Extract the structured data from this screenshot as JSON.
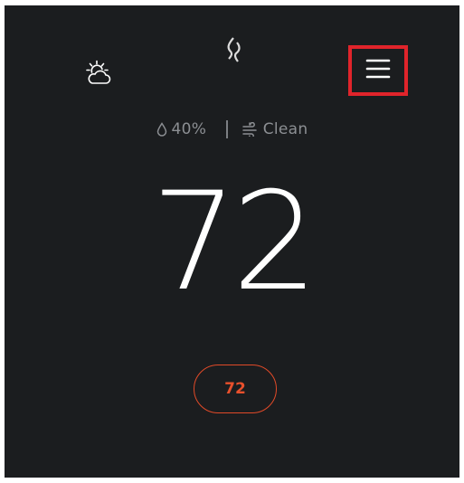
{
  "header": {
    "weather_icon": "partly-cloudy-icon",
    "logo_icon": "flame-logo-icon",
    "menu_icon": "hamburger-menu-icon",
    "menu_highlight_color": "#e0242b"
  },
  "status": {
    "humidity_icon": "droplet-icon",
    "humidity": "40%",
    "air_icon": "air-flow-icon",
    "air_quality": "Clean"
  },
  "temperature": {
    "current": "72",
    "setpoint": "72",
    "setpoint_color": "#e14a28"
  }
}
